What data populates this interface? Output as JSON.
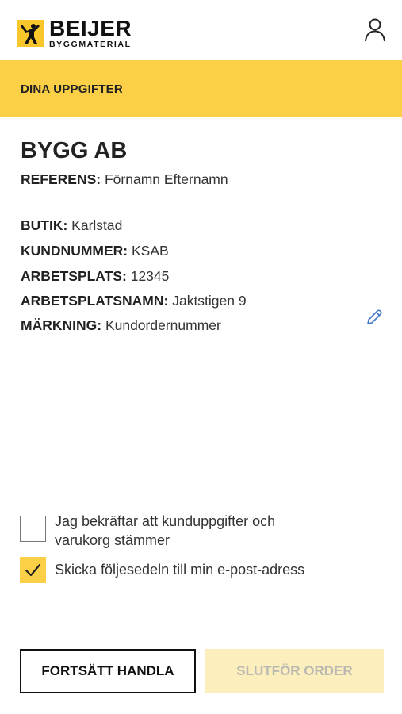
{
  "header": {
    "logo_name": "BEIJER",
    "logo_sub": "BYGGMATERIAL",
    "user_icon": "user-icon"
  },
  "banner": {
    "title": "DINA UPPGIFTER"
  },
  "customer": {
    "company": "BYGG AB",
    "reference_label": "REFERENS:",
    "reference_value": " Förnamn Efternamn",
    "fields": [
      {
        "label": "BUTIK:",
        "value": " Karlstad"
      },
      {
        "label": "KUNDNUMMER:",
        "value": " KSAB"
      },
      {
        "label": "ARBETSPLATS:",
        "value": " 12345"
      },
      {
        "label": "ARBETSPLATSNAMN:",
        "value": " Jaktstigen 9"
      },
      {
        "label": "MÄRKNING:",
        "value": " Kundordernummer"
      }
    ],
    "edit_icon": "pencil-icon"
  },
  "checks": {
    "confirm_label": "Jag bekräftar att kunduppgifter och varukorg stämmer",
    "confirm_checked": false,
    "email_label": "Skicka följesedeln till min e-post-adress",
    "email_checked": true
  },
  "actions": {
    "continue_label": "FORTSÄTT HANDLA",
    "finish_label": "SLUTFÖR ORDER"
  },
  "colors": {
    "brand_yellow": "#fbd046",
    "disabled_yellow": "#fdefbd",
    "link_blue": "#3f77c8"
  }
}
